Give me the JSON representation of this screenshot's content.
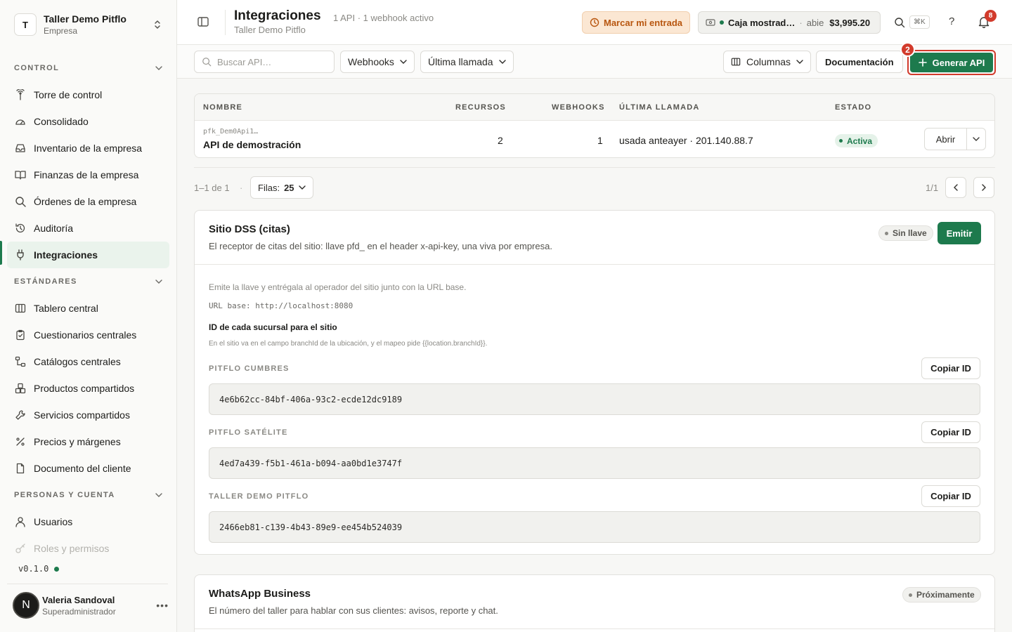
{
  "sidebar": {
    "org": {
      "initial": "T",
      "name": "Taller Demo Pitflo",
      "type": "Empresa"
    },
    "sections": [
      {
        "title": "CONTROL",
        "items": [
          "Torre de control",
          "Consolidado",
          "Inventario de la empresa",
          "Finanzas de la empresa",
          "Órdenes de la empresa",
          "Auditoría",
          "Integraciones"
        ]
      },
      {
        "title": "ESTÁNDARES",
        "items": [
          "Tablero central",
          "Cuestionarios centrales",
          "Catálogos centrales",
          "Productos compartidos",
          "Servicios compartidos",
          "Precios y márgenes",
          "Documento del cliente"
        ]
      },
      {
        "title": "PERSONAS Y CUENTA",
        "items": [
          "Usuarios",
          "Roles y permisos"
        ]
      }
    ],
    "active_item": "Integraciones",
    "version": "v0.1.0",
    "user": {
      "initial": "N",
      "name": "Valeria Sandoval",
      "role": "Superadministrador"
    }
  },
  "topbar": {
    "title": "Integraciones",
    "meta": "1 API · 1 webhook activo",
    "subtitle": "Taller Demo Pitflo",
    "clock_in_label": "Marcar mi entrada",
    "register": {
      "name": "Caja mostrad…",
      "separator": "·",
      "status": "abie",
      "amount": "$3,995.20"
    },
    "shortcut": "⌘K",
    "help": "?",
    "notifications_count": "8"
  },
  "filters": {
    "search_placeholder": "Buscar API…",
    "webhooks_label": "Webhooks",
    "last_call_label": "Última llamada",
    "columns_label": "Columnas",
    "docs_label": "Documentación",
    "generate_label": "Generar API",
    "generate_badge": "2"
  },
  "table": {
    "headers": {
      "name": "NOMBRE",
      "resources": "RECURSOS",
      "webhooks": "WEBHOOKS",
      "last_call": "ÚLTIMA LLAMADA",
      "status": "ESTADO"
    },
    "rows": [
      {
        "key": "pfk_Dem0Api1…",
        "name": "API de demostración",
        "resources": "2",
        "webhooks": "1",
        "last_call": "usada anteayer · 201.140.88.7",
        "status": "Activa",
        "action": "Abrir"
      }
    ]
  },
  "pagination": {
    "count": "1–1 de 1",
    "sep": "·",
    "rows_label": "Filas:",
    "rows_value": "25",
    "page": "1/1"
  },
  "dss_card": {
    "title": "Sitio DSS (citas)",
    "description": "El receptor de citas del sitio: llave pfd_ en el header x-api-key, una viva por empresa.",
    "badge": "Sin llave",
    "emit_label": "Emitir",
    "hint": "Emite la llave y entrégala al operador del sitio junto con la URL base.",
    "url_base": "URL base: http://localhost:8080",
    "branch_title": "ID de cada sucursal para el sitio",
    "branch_desc": "En el sitio va en el campo branchId de la ubicación, y el mapeo pide {{location.branchId}}.",
    "copy_label": "Copiar ID",
    "branches": [
      {
        "label": "PITFLO CUMBRES",
        "id": "4e6b62cc-84bf-406a-93c2-ecde12dc9189"
      },
      {
        "label": "PITFLO SATÉLITE",
        "id": "4ed7a439-f5b1-461a-b094-aa0bd1e3747f"
      },
      {
        "label": "TALLER DEMO PITFLO",
        "id": "2466eb81-c139-4b43-89e9-ee454b524039"
      }
    ]
  },
  "whatsapp_card": {
    "title": "WhatsApp Business",
    "description": "El número del taller para hablar con sus clientes: avisos, reporte y chat.",
    "badge": "Próximamente"
  },
  "colors": {
    "accent": "#1d7a4d",
    "danger": "#d23b2c",
    "warning_bg": "#fbe7d3",
    "warning_text": "#b8560f"
  }
}
